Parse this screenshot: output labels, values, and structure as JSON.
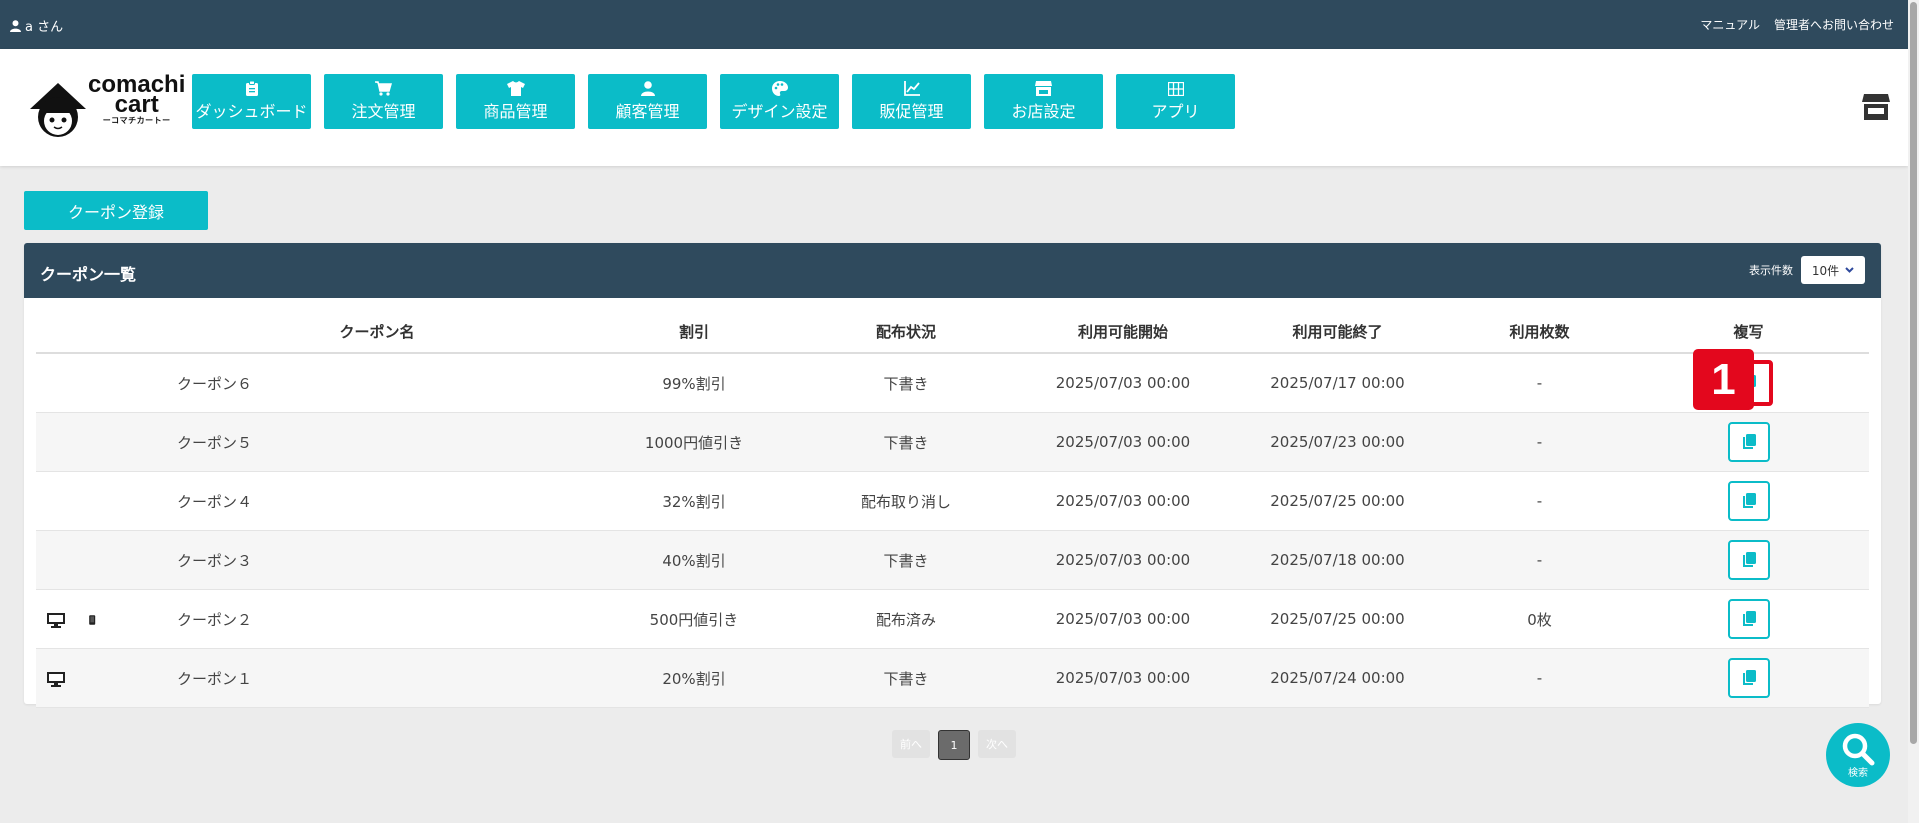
{
  "topbar": {
    "user": "a さん",
    "links": [
      "マニュアル",
      "管理者へお問い合わせ"
    ]
  },
  "logo": {
    "line1": "comachi",
    "line2": "cart",
    "sub": "ーコマチカートー"
  },
  "nav": [
    {
      "label": "ダッシュボード",
      "icon": "clipboard-icon"
    },
    {
      "label": "注文管理",
      "icon": "cart-icon"
    },
    {
      "label": "商品管理",
      "icon": "shirt-icon"
    },
    {
      "label": "顧客管理",
      "icon": "user-icon"
    },
    {
      "label": "デザイン設定",
      "icon": "palette-icon"
    },
    {
      "label": "販促管理",
      "icon": "chart-icon"
    },
    {
      "label": "お店設定",
      "icon": "store-icon"
    },
    {
      "label": "アプリ",
      "icon": "grid-icon"
    }
  ],
  "register_button": "クーポン登録",
  "panel": {
    "title": "クーポン一覧",
    "per_page_label": "表示件数",
    "per_page_value": "10件"
  },
  "table": {
    "columns": [
      "クーポン名",
      "割引",
      "配布状況",
      "利用可能開始",
      "利用可能終了",
      "利用枚数",
      "複写"
    ],
    "rows": [
      {
        "devices": [],
        "name": "クーポン６",
        "discount": "99%割引",
        "status": "下書き",
        "start": "2025/07/03 00:00",
        "end": "2025/07/17 00:00",
        "used": "-"
      },
      {
        "devices": [],
        "name": "クーポン５",
        "discount": "1000円値引き",
        "status": "下書き",
        "start": "2025/07/03 00:00",
        "end": "2025/07/23 00:00",
        "used": "-"
      },
      {
        "devices": [],
        "name": "クーポン４",
        "discount": "32%割引",
        "status": "配布取り消し",
        "start": "2025/07/03 00:00",
        "end": "2025/07/25 00:00",
        "used": "-"
      },
      {
        "devices": [],
        "name": "クーポン３",
        "discount": "40%割引",
        "status": "下書き",
        "start": "2025/07/03 00:00",
        "end": "2025/07/18 00:00",
        "used": "-"
      },
      {
        "devices": [
          "desktop-icon",
          "mobile-icon"
        ],
        "name": "クーポン２",
        "discount": "500円値引き",
        "status": "配布済み",
        "start": "2025/07/03 00:00",
        "end": "2025/07/25 00:00",
        "used": "0枚"
      },
      {
        "devices": [
          "desktop-icon"
        ],
        "name": "クーポン１",
        "discount": "20%割引",
        "status": "下書き",
        "start": "2025/07/03 00:00",
        "end": "2025/07/24 00:00",
        "used": "-"
      }
    ]
  },
  "annotation_marker": "1",
  "pager": {
    "prev": "前へ",
    "current": "1",
    "next": "次へ"
  },
  "search_fab": "検索",
  "colors": {
    "accent": "#0bbcc8",
    "header": "#2f4a5d",
    "highlight": "#e3071d"
  }
}
